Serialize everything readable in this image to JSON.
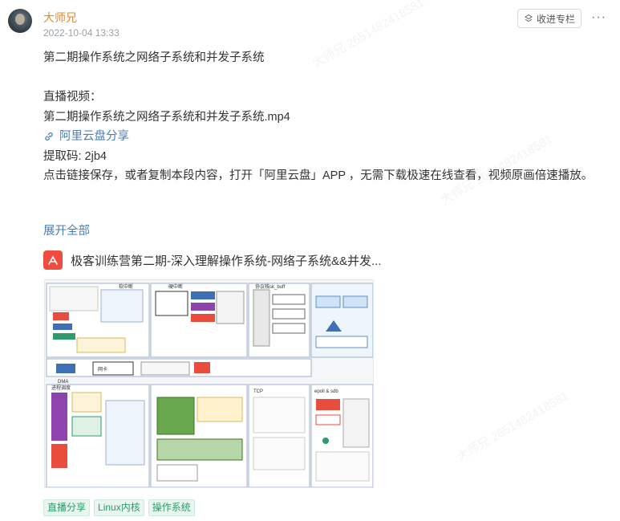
{
  "post": {
    "author": "大师兄",
    "date": "2022-10-04 13:33",
    "collect_label": "收进专栏",
    "more_label": "···"
  },
  "content": {
    "title_line": "第二期操作系统之网络子系统和并发子系统",
    "video_label": "直播视频：",
    "video_file": "第二期操作系统之网络子系统和并发子系统.mp4",
    "link_label": "阿里云盘分享",
    "code_line": "提取码: 2jb4",
    "instruction": "点击链接保存，或者复制本段内容，打开「阿里云盘」APP ，无需下载极速在线查看，视频原画倍速播放。"
  },
  "expand_label": "展开全部",
  "attachment": {
    "name": "极客训练营第二期-深入理解操作系统-网络子系统&&并发...",
    "icon": "pdf-icon"
  },
  "preview": {
    "labels": [
      "软中断",
      "硬中断",
      "存储缓冲区-L2层",
      "协议栈sk_buff",
      "QDISC",
      "网卡",
      "DMA",
      "TCP",
      "epoll & sdb",
      "进程调度"
    ]
  },
  "tags": [
    "直播分享",
    "Linux内核",
    "操作系统"
  ],
  "watermark_text": "大师兄 2651482418581",
  "colors": {
    "author": "#e08a2c",
    "link": "#4a7ebb",
    "tag_text": "#2e9b6a",
    "tag_bg": "#e9f6ef",
    "pdf_red": "#ef4c3f"
  }
}
